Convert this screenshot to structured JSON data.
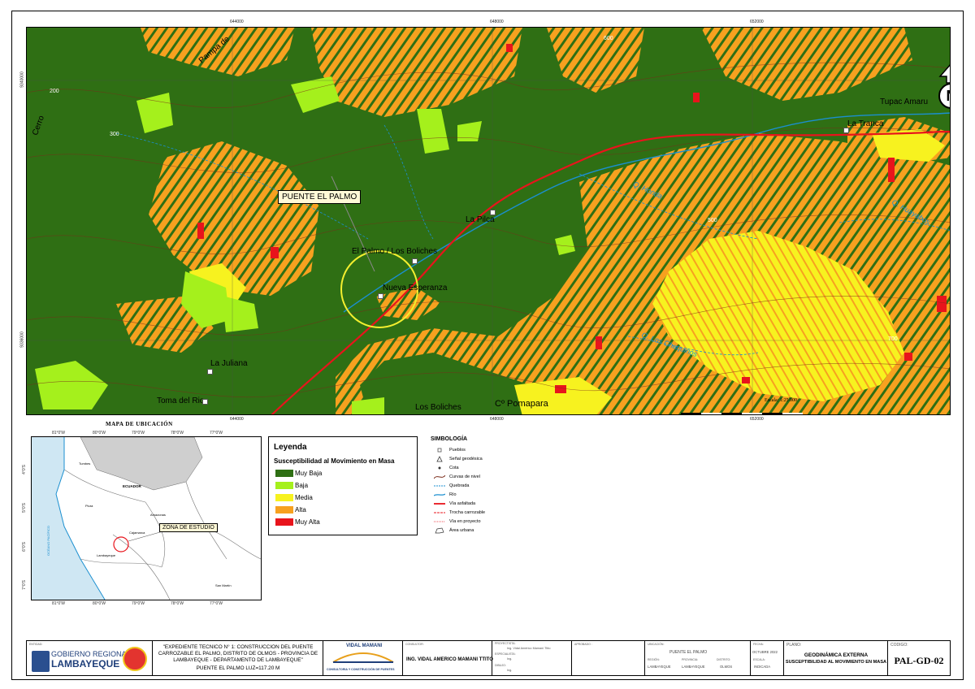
{
  "map": {
    "grid_x_labels": [
      "644000",
      "648000",
      "652000"
    ],
    "grid_y_labels": [
      "9340000",
      "9336000"
    ],
    "places": {
      "puente_callout": "PUENTE EL PALMO",
      "el_palmo": "El Palmo / Los Boliches",
      "nueva_esperanza": "Nueva Esperanza",
      "la_pilca": "La Pilca",
      "la_tranca": "La Tranca",
      "tupac_amaru": "Tupac Amaru",
      "la_juliana": "La Juliana",
      "toma_del_rio": "Toma del Rio",
      "los_boliches": "Los Boliches",
      "cerro_pomapara": "Cº Pomapara",
      "cerro_left": "Cerro",
      "pampa": "Pampa de"
    },
    "rivers": {
      "q_los_chaquinos": "Q. Los Chaquinos",
      "q_honda": "Q. Honda",
      "q_huayabos": "Q. Huayabos"
    },
    "contour_labels": [
      "200",
      "300",
      "400",
      "500",
      "600",
      "700"
    ],
    "scale_text": "Escala: 1:25 000"
  },
  "location_map": {
    "title": "MAPA DE UBICACIÓN",
    "lon_ticks": [
      "81°0'W",
      "80°0'W",
      "79°0'W",
      "78°0'W",
      "77°0'W"
    ],
    "lat_ticks": [
      "4°0'S",
      "5°0'S",
      "6°0'S",
      "7°0'S"
    ],
    "labels": {
      "ecuador": "ECUADOR",
      "tumbes": "Tumbes",
      "piura": "Piura",
      "amazonas": "Amazonas",
      "cajamarca": "Cajamarca",
      "lambayeque": "Lambayeque",
      "san_martin": "San Martín",
      "ocean": "OCÉANO PACÍFICO"
    },
    "study_zone": "ZONA DE ESTUDIO"
  },
  "legend": {
    "title": "Leyenda",
    "subtitle": "Susceptibilidad al Movimiento en Masa",
    "classes": [
      {
        "label": "Muy Baja",
        "color": "#2f6f14"
      },
      {
        "label": "Baja",
        "color": "#a5f01c"
      },
      {
        "label": "Media",
        "color": "#f7f21f"
      },
      {
        "label": "Alta",
        "color": "#f7a11f"
      },
      {
        "label": "Muy Alta",
        "color": "#e8141c"
      }
    ]
  },
  "symbology": {
    "title": "SIMBOLOGÍA",
    "items": [
      "Pueblos",
      "Señal geodésica",
      "Cota",
      "Curvas de nivel",
      "Quebrada",
      "Río",
      "Vía asfaltada",
      "Trocha carrozable",
      "Vía en proyecto",
      "Área urbana"
    ]
  },
  "title_block": {
    "entity_label": "ENTIDAD:",
    "entity_line1": "GOBIERNO REGIONAL",
    "entity_line2": "LAMBAYEQUE",
    "project_text": "\"EXPEDIENTE TECNICO N° 1: CONSTRUCCION DEL PUENTE CARROZABLE EL PALMO, DISTRITO DE OLMOS - PROVINCIA DE LAMBAYEQUE - DEPARTAMENTO DE LAMBAYEQUE\"",
    "project_sub": "PUENTE EL PALMO LUZ=117.20 M",
    "consultant_logo": "VIDAL MAMANI",
    "consultant_sub": "CONSULTORIA Y CONSTRUCCIÓN DE PUENTES",
    "consultant_label": "CONSULTOR:",
    "consultant_name": "ING. VIDAL AMERICO MAMANI TTITO",
    "proyectista_label": "PROYECTISTA:",
    "proyectista_name": "Ing. Vidal Américo Mamani Ttito",
    "especialista_label": "ESPECIALISTA:",
    "especialista_name": "Ing.",
    "dibujo_label": "DIBUJO:",
    "dibujo_name": "Ing.",
    "aprobado_label": "APROBADO :",
    "ubicacion_label": "UBICACIÓN:",
    "ubicacion_value": "PUENTE EL PALMO",
    "fecha_label": "FECHA:",
    "fecha_value": "OCTUBRE 2022",
    "region_label": "REGIÓN:",
    "region_value": "LAMBAYEQUE",
    "provincia_label": "PROVINCIA:",
    "provincia_value": "LAMBAYEQUE",
    "distrito_label": "DISTRITO:",
    "distrito_value": "OLMOS",
    "escala_label": "ESCALA:",
    "escala_value": "INDICADA",
    "plano_label": "PLANO:",
    "plano_title1": "GEODINÁMICA EXTERNA",
    "plano_title2": "SUSCEPTIBILIDAD AL MOVIMIENTO EN MASA",
    "codigo_label": "CODIGO:",
    "codigo_value": "PAL-GD-02"
  }
}
